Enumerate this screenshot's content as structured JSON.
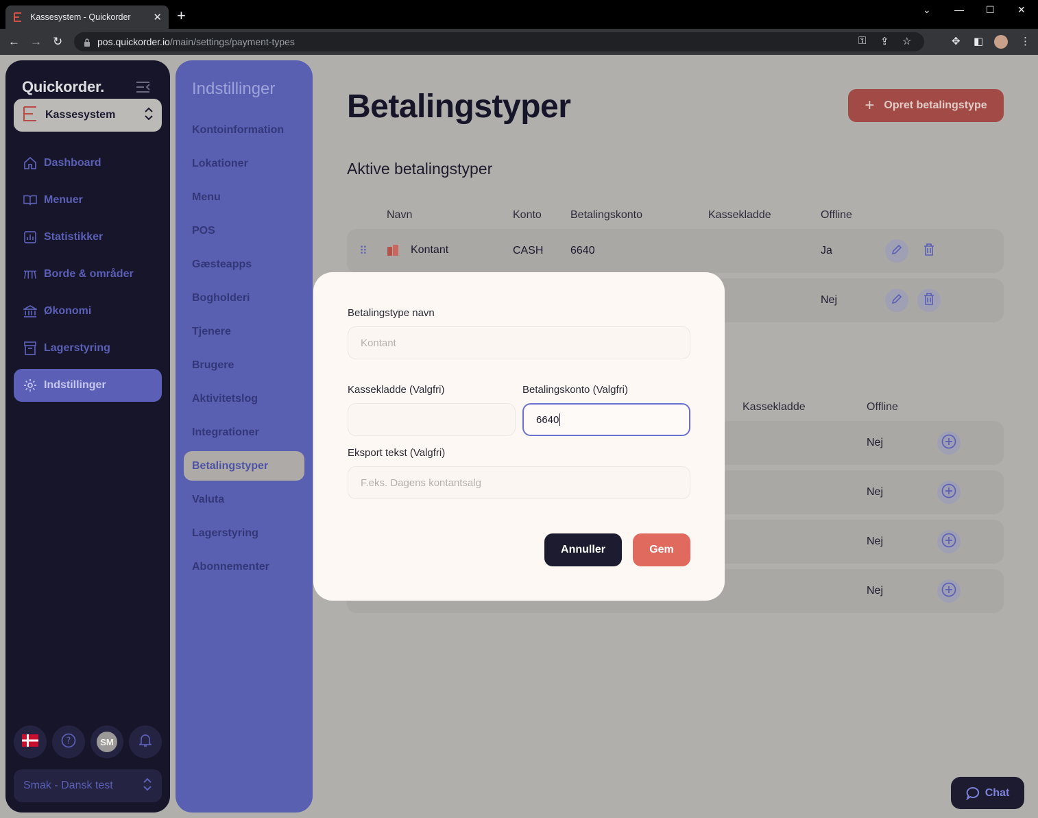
{
  "browser": {
    "tab_title": "Kassesystem - Quickorder",
    "url_host": "pos.quickorder.io",
    "url_path": "/main/settings/payment-types"
  },
  "sidebar": {
    "brand": "Quickorder.",
    "system_select": "Kassesystem",
    "items": [
      {
        "label": "Dashboard",
        "icon": "home-icon"
      },
      {
        "label": "Menuer",
        "icon": "book-icon"
      },
      {
        "label": "Statistikker",
        "icon": "chart-icon"
      },
      {
        "label": "Borde & områder",
        "icon": "table-icon"
      },
      {
        "label": "Økonomi",
        "icon": "bank-icon"
      },
      {
        "label": "Lagerstyring",
        "icon": "archive-icon"
      },
      {
        "label": "Indstillinger",
        "icon": "gear-icon",
        "active": true
      }
    ],
    "avatar_initials": "SM",
    "venue_select": "Smak - Dansk test"
  },
  "settings_menu": {
    "title": "Indstillinger",
    "items": [
      "Kontoinformation",
      "Lokationer",
      "Menu",
      "POS",
      "Gæsteapps",
      "Bogholderi",
      "Tjenere",
      "Brugere",
      "Aktivitetslog",
      "Integrationer",
      "Betalingstyper",
      "Valuta",
      "Lagerstyring",
      "Abonnementer"
    ],
    "active": "Betalingstyper"
  },
  "main": {
    "title": "Betalingstyper",
    "create_button": "Opret betalingstype",
    "active_section_title": "Aktive betalingstyper",
    "columns": {
      "name": "Navn",
      "account": "Konto",
      "payment_account": "Betalingskonto",
      "cash_journal": "Kassekladde",
      "offline": "Offline"
    },
    "active_rows": [
      {
        "name": "Kontant",
        "account": "CASH",
        "payment_account": "6640",
        "offline": "Ja"
      },
      {
        "offline": "Nej"
      }
    ],
    "inactive_columns": {
      "cash_journal": "Kassekladde",
      "offline": "Offline"
    },
    "inactive_rows": [
      {
        "offline": "Nej"
      },
      {
        "offline": "Nej"
      },
      {
        "offline": "Nej"
      },
      {
        "offline": "Nej"
      }
    ]
  },
  "modal": {
    "name_label": "Betalingstype navn",
    "name_placeholder": "Kontant",
    "cash_journal_label": "Kassekladde (Valgfri)",
    "cash_journal_value": "",
    "payment_account_label": "Betalingskonto (Valgfri)",
    "payment_account_value": "6640",
    "export_label": "Eksport tekst (Valgfri)",
    "export_placeholder": "F.eks. Dagens kontantsalg",
    "cancel": "Annuller",
    "save": "Gem"
  },
  "chat": {
    "label": "Chat"
  },
  "colors": {
    "accent": "#5b5fb5",
    "primary_red": "#e16a5e",
    "dark": "#16152a"
  }
}
